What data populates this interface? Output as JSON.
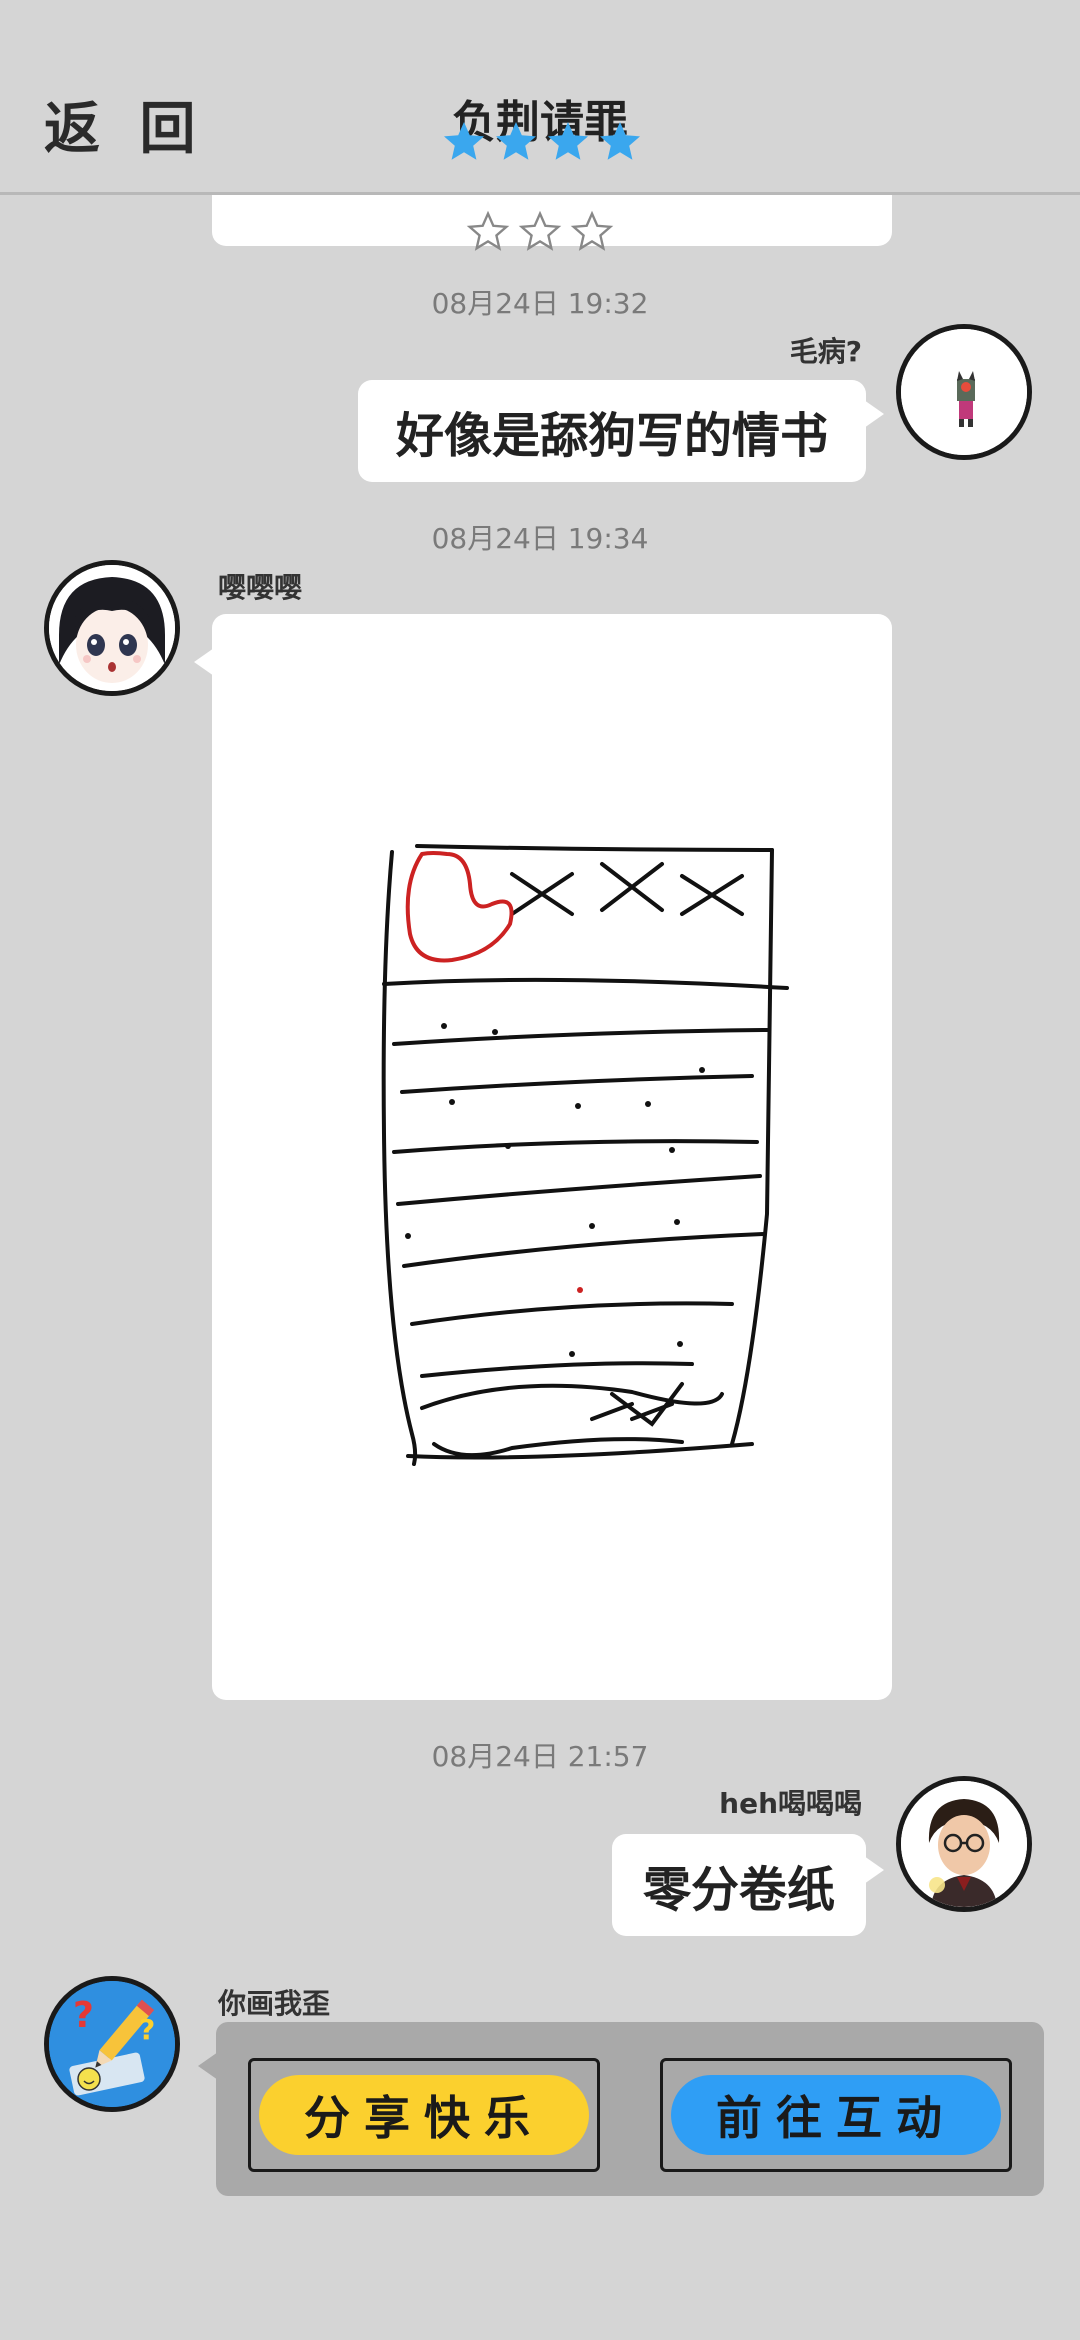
{
  "header": {
    "back_label": "返 回",
    "title": "负荆请罪"
  },
  "colors": {
    "background": "#d5d5d5",
    "star_blue": "#3aa7ee",
    "share_yellow": "#fbd02e",
    "goto_blue": "#2f9ef5",
    "bubble": "#ffffff"
  },
  "messages": [
    {
      "timestamp": "08月24日  19:32",
      "user": "毛病?",
      "text": "好像是舔狗写的情书",
      "side": "right"
    },
    {
      "timestamp": "08月24日  19:34",
      "user": "嘤嘤嘤",
      "type": "image",
      "side": "left"
    },
    {
      "timestamp": "08月24日  21:57",
      "user": "heh喝喝喝",
      "text": "零分卷纸",
      "side": "right"
    },
    {
      "user": "你画我歪",
      "side": "left",
      "type": "actions"
    }
  ],
  "actions": {
    "share_label": "分享快乐",
    "goto_label": "前往互动"
  },
  "icons": [
    "star-filled-icon",
    "star-outline-icon",
    "pencil-question-icon"
  ]
}
